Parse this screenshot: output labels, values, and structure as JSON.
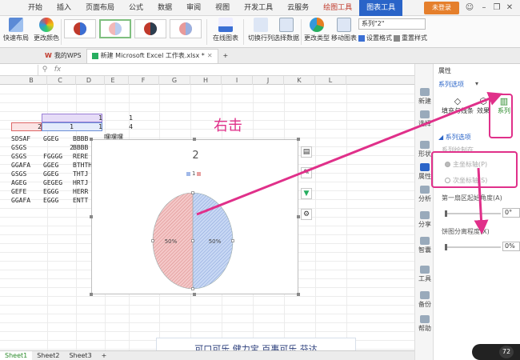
{
  "menu": {
    "items": [
      "开始",
      "插入",
      "页面布局",
      "公式",
      "数据",
      "审阅",
      "视图",
      "开发工具",
      "云服务",
      "绘图工具",
      "图表工具"
    ],
    "login": "未登录"
  },
  "ribbon": {
    "quick_layout": "快速布局",
    "change_color": "更改颜色",
    "online_chart": "在线图表",
    "switch_row_col": "切换行列",
    "select_data": "选择数据",
    "change_type": "更改类型",
    "move_chart": "移动图表",
    "series_select": "系列\"2\"",
    "set_format": "设置格式",
    "reset_style": "重置样式"
  },
  "tabs": {
    "wps": "我的WPS",
    "doc": "新建 Microsoft Excel 工作表.xlsx *",
    "plus": "+"
  },
  "formula": {
    "fx": "fx"
  },
  "grid": {
    "columns": [
      "B",
      "C",
      "D",
      "E",
      "F",
      "G",
      "H",
      "I",
      "J",
      "K",
      "L"
    ],
    "rows": [
      {
        "B": "SDSAF",
        "C": "GGEG",
        "D": "BBBB"
      },
      {
        "B": "GSGS",
        "C": "2",
        "D": "BBBB"
      },
      {
        "B": "GSGS",
        "C": "FGGGG",
        "D": "RERE"
      },
      {
        "B": "GGAFA",
        "C": "GGEG",
        "D": "BTHTH"
      },
      {
        "B": "GSGS",
        "C": "GGEG",
        "D": "THTJ"
      },
      {
        "B": "AGEG",
        "C": "GEGEG",
        "D": "HRTJ"
      },
      {
        "B": "GEFE",
        "C": "EGGG",
        "D": "HERR"
      },
      {
        "B": "GGAFA",
        "C": "EGGG",
        "D": "ENTT"
      }
    ],
    "header_row1": {
      "D": "1",
      "E": "1"
    },
    "header_row2": {
      "B": "2",
      "C": "1",
      "D": "1",
      "E": "4"
    },
    "e_text": "嘿嘿嘿"
  },
  "chart": {
    "title": "2",
    "legend": "1",
    "slice_labels": [
      "50%",
      "50%"
    ],
    "annotation": "右击"
  },
  "chart_data": {
    "type": "pie",
    "title": "2",
    "categories": [
      "",
      ""
    ],
    "values": [
      50,
      50
    ],
    "series": [
      {
        "name": "1",
        "values": [
          50,
          50
        ]
      }
    ],
    "colors": [
      "#e8a0a0",
      "#a0b8e8"
    ]
  },
  "sidebar": {
    "items": [
      "新建",
      "选择",
      "形状",
      "属性",
      "分析",
      "分享",
      "智囊",
      "工具",
      "备份",
      "帮助"
    ]
  },
  "panel": {
    "title": "属性",
    "tab_series": "系列选项",
    "tab_fill": "填充与线条",
    "tab_effects": "效果",
    "tab_series_short": "系列",
    "section": "系列选项",
    "axis_label": "系列绘制在",
    "primary_axis": "主坐标轴(P)",
    "secondary_axis": "次坐标轴(S)",
    "first_slice_angle": "第一扇区起始角度(A)",
    "angle_value": "0°",
    "explosion": "饼图分离程度(X)",
    "explosion_value": "0%"
  },
  "sheets": [
    "Sheet1",
    "Sheet2",
    "Sheet3",
    "+"
  ],
  "bottom_text": "可口可乐 健力宝 百事可乐 芬达",
  "widget": {
    "speed": "72"
  },
  "colors": {
    "accent": "#2a64c8",
    "annotation": "#e0308a"
  }
}
